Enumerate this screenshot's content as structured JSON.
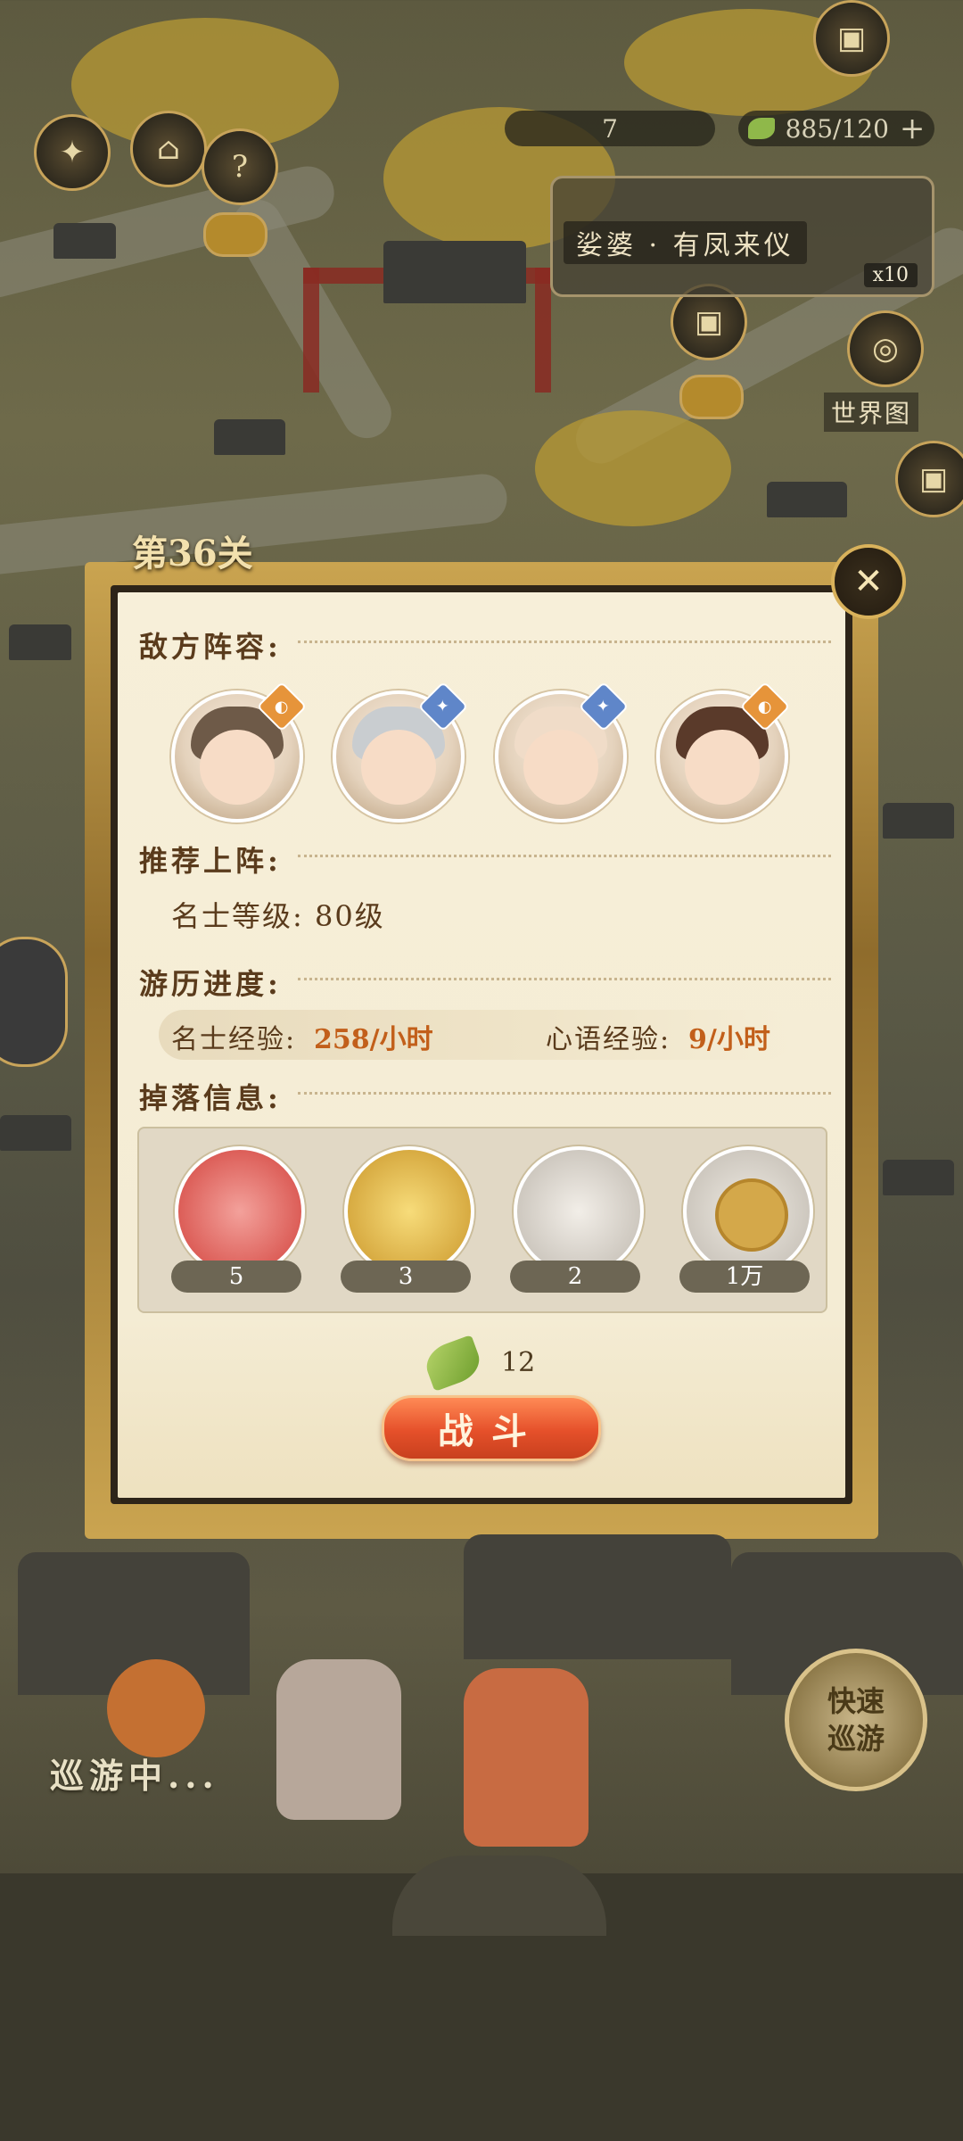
{
  "topbar": {
    "stamina_value": "7",
    "energy_value": "885/120",
    "add_label": "+"
  },
  "banner": {
    "title": "娑婆 · 有凤来仪",
    "count": "x10"
  },
  "world_map": {
    "label": "世界图"
  },
  "stage": {
    "title": "第36关",
    "sections": {
      "enemy_lineup": "敌方阵容:",
      "recommended": "推荐上阵:",
      "progress": "游历进度:",
      "drops": "掉落信息:"
    },
    "recommended_level_label": "名士等级:",
    "recommended_level_value": "80级",
    "progress_items": [
      {
        "label": "名士经验:",
        "value": "258/小时"
      },
      {
        "label": "心语经验:",
        "value": "9/小时"
      }
    ],
    "drops": [
      {
        "count": "5"
      },
      {
        "count": "3"
      },
      {
        "count": "2"
      },
      {
        "count": "1万"
      }
    ],
    "cost": "12",
    "fight_label": "战斗"
  },
  "bottom": {
    "patrol_text": "巡游中...",
    "quick_patrol_line1": "快速",
    "quick_patrol_line2": "巡游"
  },
  "colors": {
    "accent_gold": "#caa450",
    "fight_button": "#e5502a",
    "value_orange": "#c25f1a"
  }
}
